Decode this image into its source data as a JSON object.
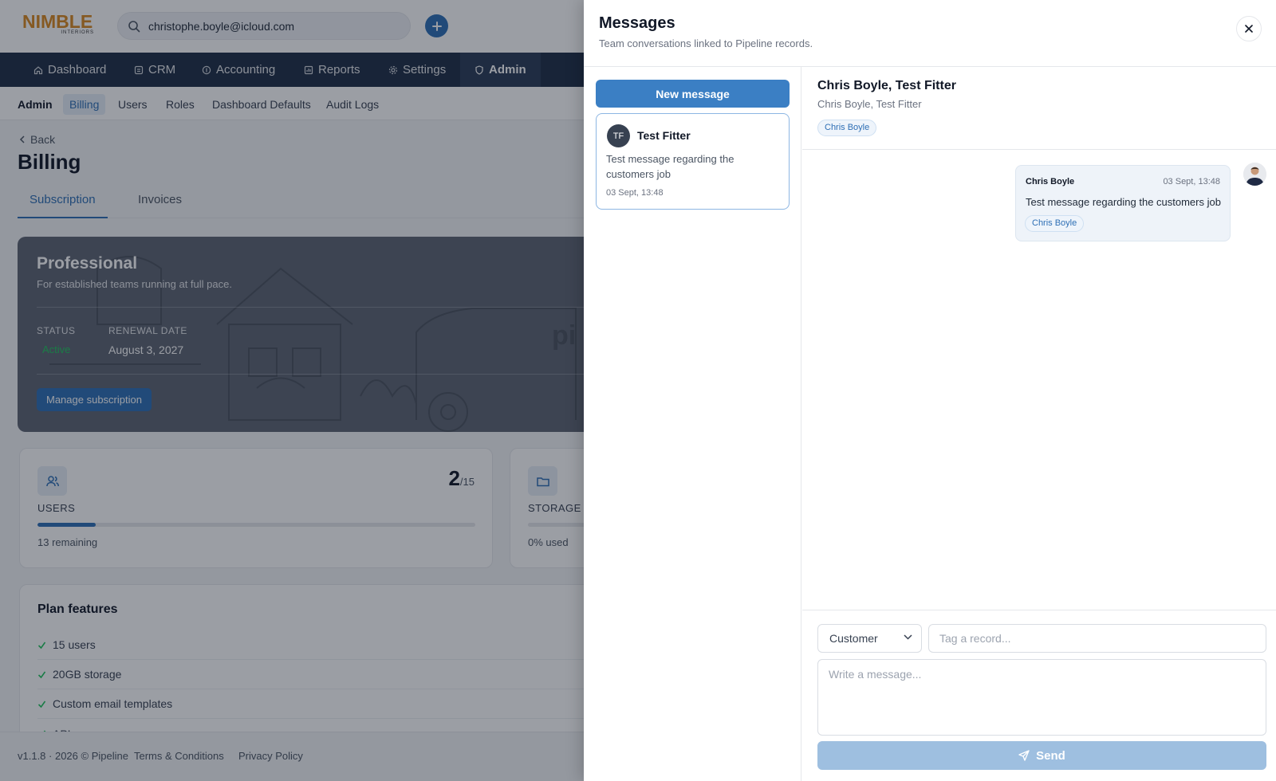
{
  "app": {
    "logo": {
      "brand_main": "NIMBLE",
      "brand_sub": "INTERIORS"
    },
    "search": {
      "value": "christophe.boyle@icloud.com"
    },
    "main_nav": [
      {
        "label": "Dashboard",
        "icon": "home-icon"
      },
      {
        "label": "CRM",
        "icon": "contacts-icon"
      },
      {
        "label": "Accounting",
        "icon": "currency-icon"
      },
      {
        "label": "Reports",
        "icon": "chart-icon"
      },
      {
        "label": "Settings",
        "icon": "gear-icon"
      },
      {
        "label": "Admin",
        "icon": "shield-icon",
        "active": true
      }
    ],
    "sub_nav": [
      {
        "label": "Admin"
      },
      {
        "label": "Billing",
        "active": true
      },
      {
        "label": "Users"
      },
      {
        "label": "Roles"
      },
      {
        "label": "Dashboard Defaults"
      },
      {
        "label": "Audit Logs"
      }
    ],
    "back_label": "Back",
    "page_title": "Billing",
    "tabs": [
      {
        "label": "Subscription",
        "active": true
      },
      {
        "label": "Invoices"
      }
    ],
    "plan": {
      "name": "Professional",
      "description": "For established teams running at full pace.",
      "status_label": "STATUS",
      "status_value": "Active",
      "renewal_label": "RENEWAL DATE",
      "renewal_value": "August 3, 2027",
      "manage_label": "Manage subscription"
    },
    "stats": [
      {
        "label": "USERS",
        "used": "2",
        "total": "/15",
        "sub": "13 remaining",
        "progress": 0.133,
        "icon": "users-icon"
      },
      {
        "label": "STORAGE",
        "used": "",
        "total": "",
        "sub": "0% used",
        "progress": 0.0,
        "icon": "folder-icon"
      }
    ],
    "features": {
      "title": "Plan features",
      "items": [
        "15 users",
        "20GB storage",
        "Custom email templates",
        "API access"
      ]
    },
    "footer": {
      "version": "v1.1.8 · 2026 © Pipeline",
      "terms": "Terms & Conditions",
      "privacy": "Privacy Policy"
    }
  },
  "messages_panel": {
    "title": "Messages",
    "subtitle": "Team conversations linked to Pipeline records.",
    "new_message_label": "New message",
    "conversations": [
      {
        "initials": "TF",
        "name": "Test Fitter",
        "preview": "Test message regarding the customers job",
        "time": "03 Sept, 13:48"
      }
    ],
    "thread": {
      "title": "Chris Boyle, Test Fitter",
      "participants": "Chris Boyle, Test Fitter",
      "tag": "Chris Boyle",
      "messages": [
        {
          "author": "Chris Boyle",
          "time": "03 Sept, 13:48",
          "text": "Test message regarding the customers job",
          "tag": "Chris Boyle"
        }
      ]
    },
    "composer": {
      "record_type": "Customer",
      "tag_placeholder": "Tag a record...",
      "message_placeholder": "Write a message...",
      "send_label": "Send"
    }
  },
  "colors": {
    "accent": "#2e6fb5",
    "nav_bg": "#1e2e45",
    "status_active": "#22c55e",
    "send_disabled": "#9ebfe0"
  }
}
